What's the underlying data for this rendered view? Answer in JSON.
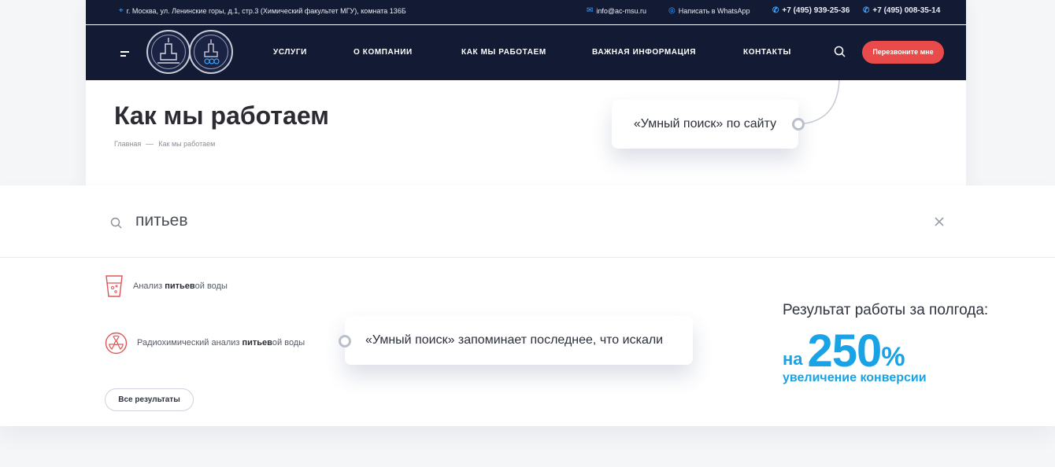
{
  "topbar": {
    "address": "г. Москва, ул. Ленинские горы, д.1, стр.3 (Химический факультет МГУ), комната 136Б",
    "email": "info@ac-msu.ru",
    "whatsapp": "Написать в WhatsApp",
    "phone1": "+7 (495) 939-25-36",
    "phone2": "+7 (495) 008-35-14"
  },
  "nav": {
    "items": [
      "УСЛУГИ",
      "О КОМПАНИИ",
      "КАК МЫ РАБОТАЕМ",
      "ВАЖНАЯ ИНФОРМАЦИЯ",
      "КОНТАКТЫ"
    ],
    "callback": "Перезвоните мне"
  },
  "page": {
    "title": "Как мы работаем",
    "breadcrumb": [
      "Главная",
      "Как мы работаем"
    ]
  },
  "callouts": {
    "first": "«Умный поиск» по сайту",
    "second": "«Умный поиск» запоминает последнее, что искали"
  },
  "search": {
    "query": "питьев",
    "results": [
      {
        "before": "Анализ ",
        "match": "питьев",
        "after": "ой воды",
        "icon": "water-glass-icon"
      },
      {
        "before": "Радиохимический анализ ",
        "match": "питьев",
        "after": "ой воды",
        "icon": "radiation-icon"
      }
    ],
    "all_results": "Все результаты"
  },
  "result": {
    "heading": "Результат работы за полгода:",
    "prefix": "на",
    "number": "250",
    "percent": "%",
    "subtitle": "увеличение конверсии"
  },
  "colors": {
    "navy": "#131a33",
    "accent_red": "#e94b4b",
    "accent_blue": "#17a3e6",
    "link_blue": "#3fa5ff"
  }
}
